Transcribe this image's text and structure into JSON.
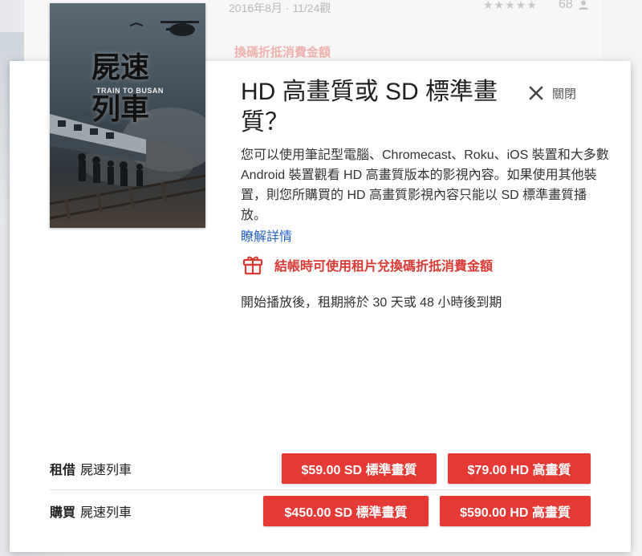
{
  "background": {
    "date_text": "2016年8月 · 11/24觀",
    "stars": "★★★★★",
    "rating_count": "68",
    "promo_text": "換碼折抵消費金額"
  },
  "poster": {
    "title_line1": "屍速",
    "title_line2": "列車",
    "subtitle": "TRAIN TO BUSAN"
  },
  "dialog": {
    "title": "HD 高畫質或 SD 標準畫質？",
    "close_label": "關閉",
    "description": "您可以使用筆記型電腦、Chromecast、Roku、iOS 裝置和大多數 Android 裝置觀看 HD 高畫質版本的影視內容。如果使用其他裝置，則您所購買的 HD 高畫質影視內容只能以 SD 標準畫質播放。",
    "learn_more": "瞭解詳情",
    "promo": "結帳時可使用租片兌換碼折抵消費金額",
    "rental_note": "開始播放後，租期將於 30 天或 48 小時後到期"
  },
  "rent": {
    "label": "租借",
    "movie": "屍速列車",
    "sd_button": "$59.00 SD 標準畫質",
    "hd_button": "$79.00 HD 高畫質"
  },
  "buy": {
    "label": "購買",
    "movie": "屍速列車",
    "sd_button": "$450.00 SD 標準畫質",
    "hd_button": "$590.00 HD 高畫質"
  },
  "colors": {
    "accent": "#e53935",
    "promo": "#db3a34",
    "link": "#2561c4"
  }
}
